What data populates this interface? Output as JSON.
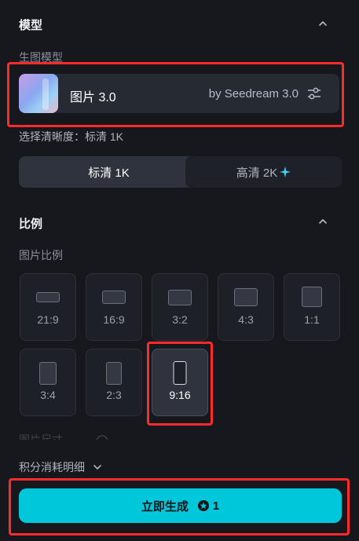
{
  "model_section": {
    "title": "模型",
    "sub_label": "生图模型",
    "model_name": "图片 3.0",
    "model_by": "by Seedream 3.0"
  },
  "quality": {
    "label": "选择清晰度：标清 1K",
    "options": [
      {
        "label": "标清 1K",
        "selected": true
      },
      {
        "label": "高清 2K",
        "selected": false
      }
    ]
  },
  "ratio_section": {
    "title": "比例",
    "sub_label": "图片比例",
    "ratios": [
      "21:9",
      "16:9",
      "3:2",
      "4:3",
      "1:1",
      "3:4",
      "2:3",
      "9:16"
    ],
    "selected": "9:16",
    "partial_label": "图片尺寸"
  },
  "credits": {
    "label": "积分消耗明细"
  },
  "generate": {
    "label": "立即生成",
    "cost": "1"
  },
  "colors": {
    "accent": "#00c7d9",
    "highlight": "#ff2b2b",
    "spark": "#3fd3ff"
  }
}
